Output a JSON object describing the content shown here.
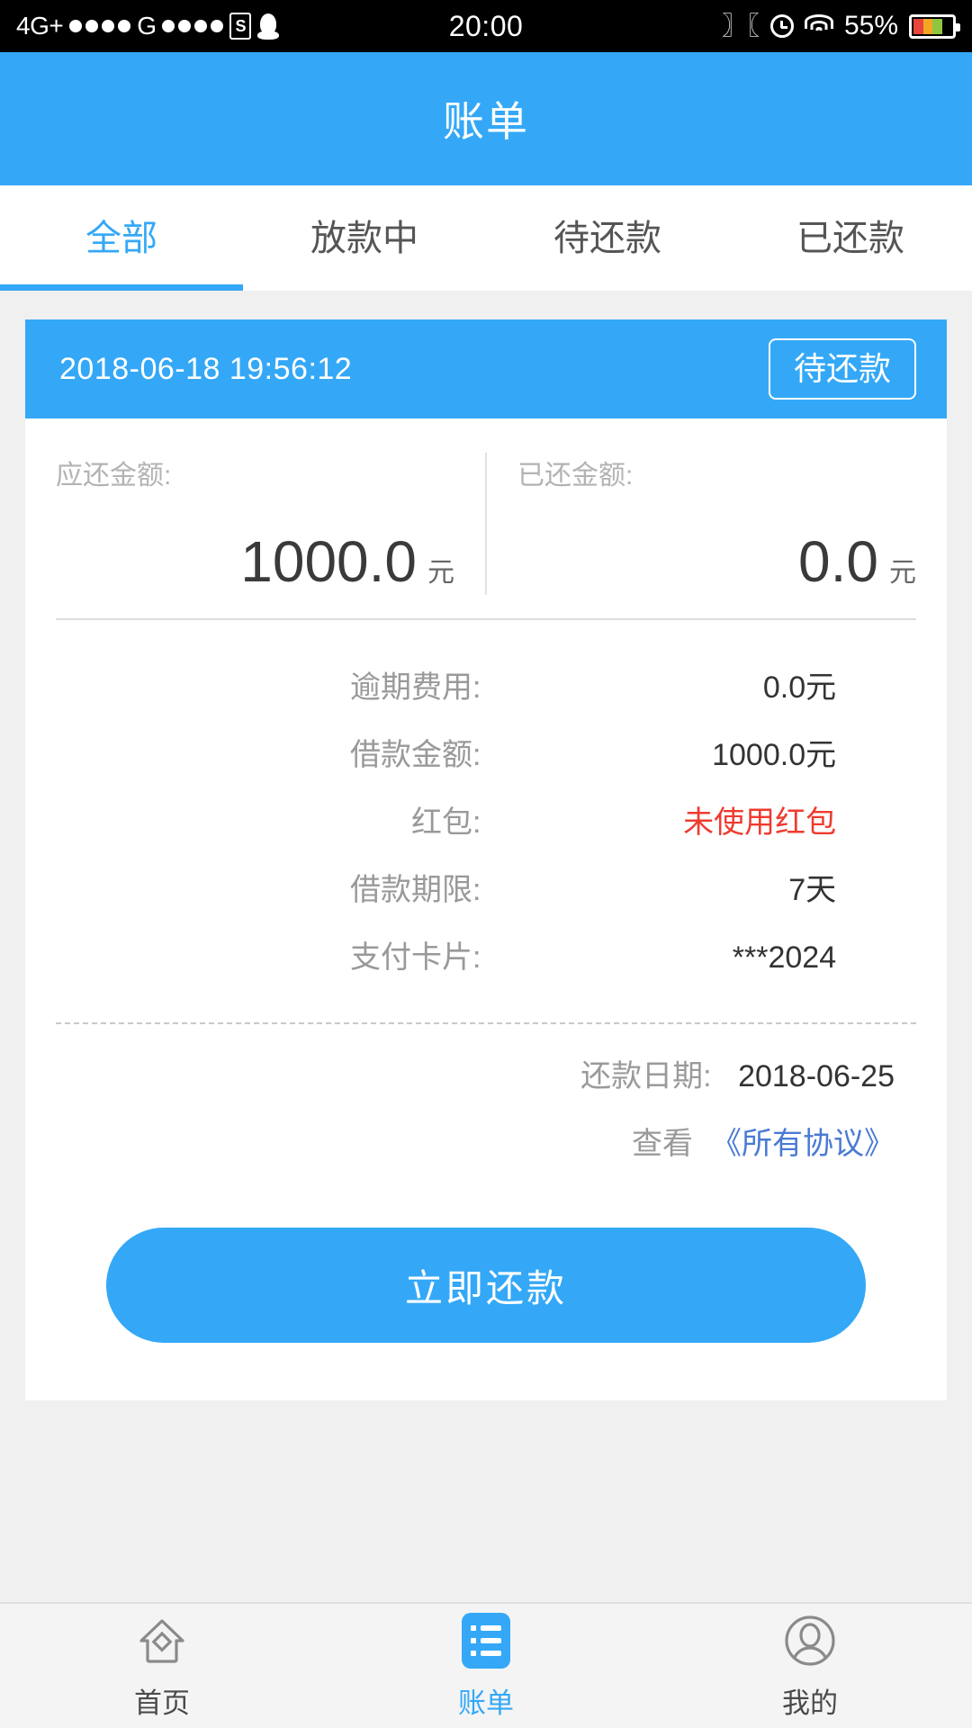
{
  "status_bar": {
    "network_primary": "4G+",
    "network_secondary": "G",
    "app_icon_letter": "S",
    "qq_icon": "qq-penguin-icon",
    "time": "20:00",
    "vibrate_icon": "vibrate-icon",
    "alarm_icon": "alarm-clock-icon",
    "wifi_icon": "wifi-icon",
    "battery_percent": "55%"
  },
  "header": {
    "title": "账单"
  },
  "tabs": [
    {
      "label": "全部",
      "active": true
    },
    {
      "label": "放款中",
      "active": false
    },
    {
      "label": "待还款",
      "active": false
    },
    {
      "label": "已还款",
      "active": false
    }
  ],
  "card": {
    "datetime": "2018-06-18 19:56:12",
    "status_badge": "待还款",
    "amounts": [
      {
        "label": "应还金额:",
        "value": "1000.0",
        "unit": "元"
      },
      {
        "label": "已还金额:",
        "value": "0.0",
        "unit": "元"
      }
    ],
    "details": [
      {
        "label": "逾期费用:",
        "value": "0.0元",
        "highlight": false
      },
      {
        "label": "借款金额:",
        "value": "1000.0元",
        "highlight": false
      },
      {
        "label": "红包:",
        "value": "未使用红包",
        "highlight": true
      },
      {
        "label": "借款期限:",
        "value": "7天",
        "highlight": false
      },
      {
        "label": "支付卡片:",
        "value": "***2024",
        "highlight": false
      }
    ],
    "repay_date_label": "还款日期:",
    "repay_date_value": "2018-06-25",
    "agreement_prefix": "查看",
    "agreement_link": "《所有协议》",
    "repay_button": "立即还款"
  },
  "bottom_nav": [
    {
      "label": "首页",
      "icon": "home-icon",
      "active": false
    },
    {
      "label": "账单",
      "icon": "bill-list-icon",
      "active": true
    },
    {
      "label": "我的",
      "icon": "person-icon",
      "active": false
    }
  ],
  "colors": {
    "accent": "#34a8f7",
    "danger": "#ee3b2f",
    "link": "#4a7ad4"
  }
}
